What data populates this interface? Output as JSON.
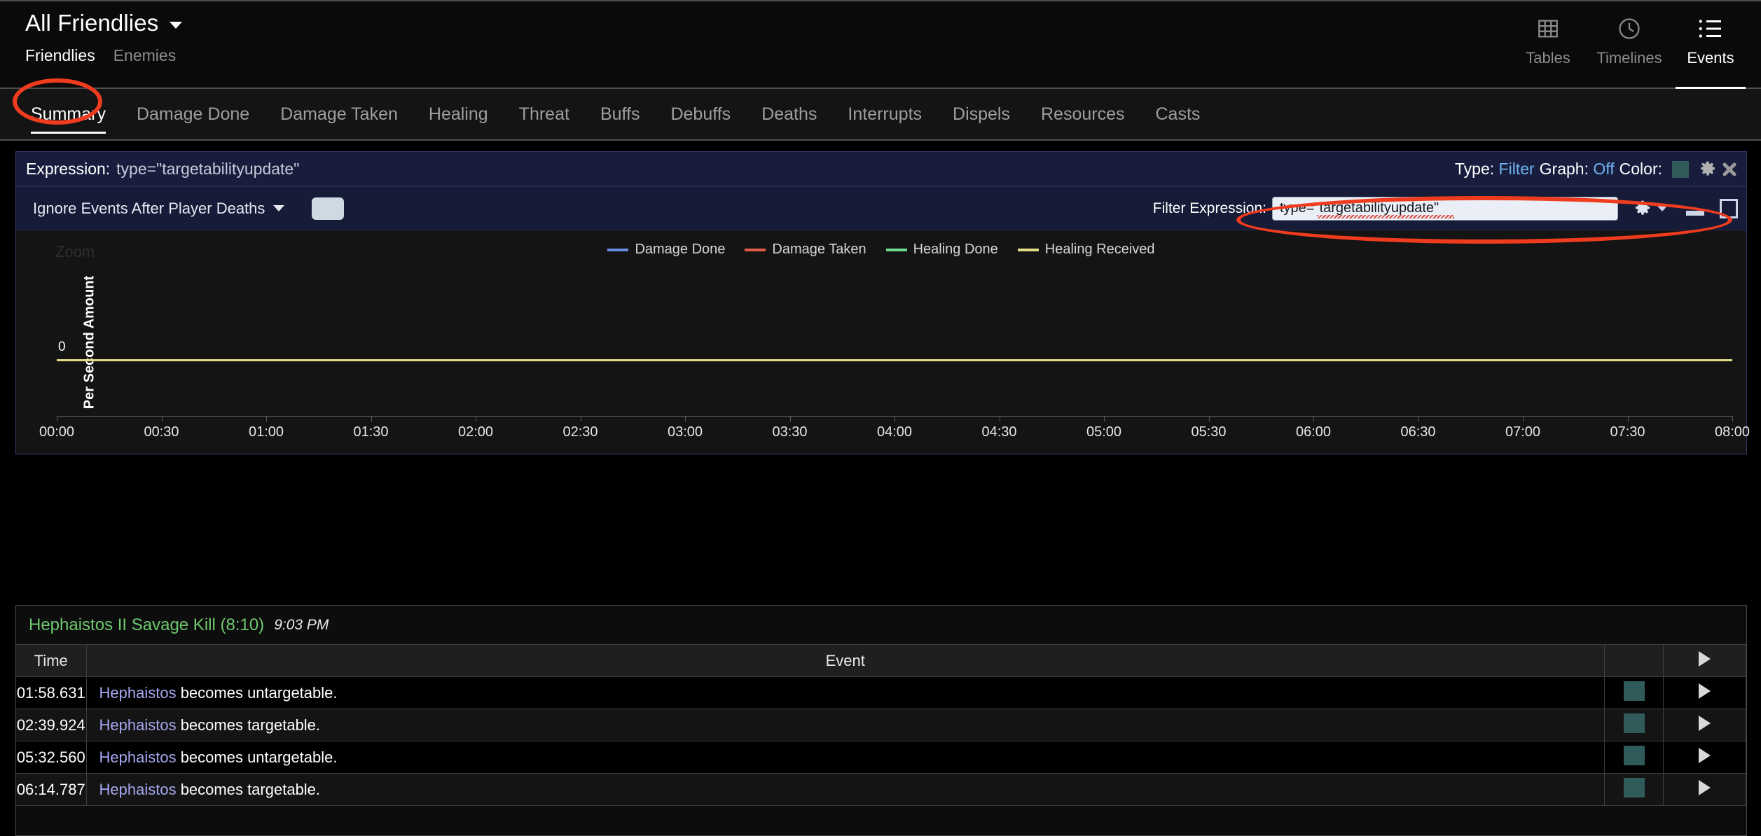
{
  "header": {
    "title": "All Friendlies",
    "caret_icon": "chevron-down-icon",
    "subtabs": [
      {
        "label": "Friendlies",
        "active": true
      },
      {
        "label": "Enemies",
        "active": false
      }
    ],
    "modes": [
      {
        "label": "Tables",
        "icon": "grid-icon",
        "active": false
      },
      {
        "label": "Timelines",
        "icon": "clock-icon",
        "active": false
      },
      {
        "label": "Events",
        "icon": "list-icon",
        "active": true
      }
    ]
  },
  "tabs": [
    {
      "label": "Summary",
      "active": true
    },
    {
      "label": "Damage Done",
      "active": false
    },
    {
      "label": "Damage Taken",
      "active": false
    },
    {
      "label": "Healing",
      "active": false
    },
    {
      "label": "Threat",
      "active": false
    },
    {
      "label": "Buffs",
      "active": false
    },
    {
      "label": "Debuffs",
      "active": false
    },
    {
      "label": "Deaths",
      "active": false
    },
    {
      "label": "Interrupts",
      "active": false
    },
    {
      "label": "Dispels",
      "active": false
    },
    {
      "label": "Resources",
      "active": false
    },
    {
      "label": "Casts",
      "active": false
    }
  ],
  "expression_bar": {
    "label": "Expression:",
    "value": "type=\"targetabilityupdate\"",
    "type_label": "Type:",
    "type_value": "Filter",
    "graph_label": "Graph:",
    "graph_value": "Off",
    "color_label": "Color:",
    "color_swatch": "#2f5b5b",
    "gear_icon": "gear-icon",
    "close_icon": "close-icon"
  },
  "toolbar": {
    "death_filter": "Ignore Events After Player Deaths",
    "caret_icon": "chevron-down-icon",
    "blank_button_label": "",
    "filter_label": "Filter Expression:",
    "filter_value": "type=\"targetabilityupdate\"",
    "filter_placeholder": "Filter Expression",
    "gear_icon": "gear-icon",
    "minimize_icon": "minimize-icon",
    "maximize_icon": "maximize-icon"
  },
  "chart_data": {
    "type": "line",
    "title": "",
    "zoom_label": "Zoom",
    "ylabel": "Per Second Amount",
    "xlabel": "",
    "yticks": [
      "0"
    ],
    "ylim": [
      0,
      0
    ],
    "grid": false,
    "legend_position": "top-center",
    "x": [
      "00:00",
      "00:30",
      "01:00",
      "01:30",
      "02:00",
      "02:30",
      "03:00",
      "03:30",
      "04:00",
      "04:30",
      "05:00",
      "05:30",
      "06:00",
      "06:30",
      "07:00",
      "07:30",
      "08:00"
    ],
    "series": [
      {
        "name": "Damage Done",
        "color": "#6b8ee0",
        "values": [
          0,
          0,
          0,
          0,
          0,
          0,
          0,
          0,
          0,
          0,
          0,
          0,
          0,
          0,
          0,
          0,
          0
        ]
      },
      {
        "name": "Damage Taken",
        "color": "#e05c4a",
        "values": [
          0,
          0,
          0,
          0,
          0,
          0,
          0,
          0,
          0,
          0,
          0,
          0,
          0,
          0,
          0,
          0,
          0
        ]
      },
      {
        "name": "Healing Done",
        "color": "#6fdc8c",
        "values": [
          0,
          0,
          0,
          0,
          0,
          0,
          0,
          0,
          0,
          0,
          0,
          0,
          0,
          0,
          0,
          0,
          0
        ]
      },
      {
        "name": "Healing Received",
        "color": "#e2dc84",
        "values": [
          0,
          0,
          0,
          0,
          0,
          0,
          0,
          0,
          0,
          0,
          0,
          0,
          0,
          0,
          0,
          0,
          0
        ]
      }
    ]
  },
  "events": {
    "fight_name": "Hephaistos II Savage Kill (8:10)",
    "fight_time": "9:03 PM",
    "columns": [
      "Time",
      "Event",
      "",
      ""
    ],
    "rows": [
      {
        "time": "01:58.631",
        "actor": "Hephaistos",
        "text": " becomes untargetable.",
        "color": "#2f5b5b",
        "expand": "expand-icon"
      },
      {
        "time": "02:39.924",
        "actor": "Hephaistos",
        "text": " becomes targetable.",
        "color": "#2f5b5b",
        "expand": "expand-icon"
      },
      {
        "time": "05:32.560",
        "actor": "Hephaistos",
        "text": " becomes untargetable.",
        "color": "#2f5b5b",
        "expand": "expand-icon"
      },
      {
        "time": "06:14.787",
        "actor": "Hephaistos",
        "text": " becomes targetable.",
        "color": "#2f5b5b",
        "expand": "expand-icon"
      }
    ]
  },
  "annotations": [
    {
      "name": "summary-tab-highlight",
      "color": "#ef3b1e"
    },
    {
      "name": "filter-expression-highlight",
      "color": "#ef3b1e"
    }
  ]
}
